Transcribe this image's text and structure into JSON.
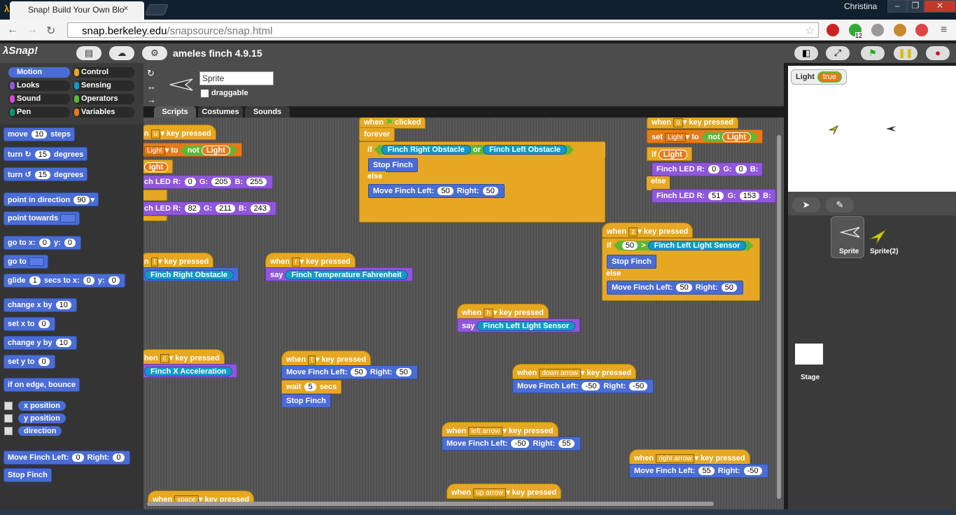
{
  "browser": {
    "tab_title": "Snap! Build Your Own Blo",
    "user": "Christina",
    "url_domain": "snap.berkeley.edu",
    "url_path": "/snapsource/snap.html",
    "ext_badge": "12"
  },
  "snap": {
    "logo": "λSnap!",
    "project_title": "ameles finch 4.9.15"
  },
  "categories": [
    {
      "label": "Motion",
      "color": "#4a6cd4"
    },
    {
      "label": "Control",
      "color": "#e6a822"
    },
    {
      "label": "Looks",
      "color": "#8f57d9"
    },
    {
      "label": "Sensing",
      "color": "#0d9ac9"
    },
    {
      "label": "Sound",
      "color": "#cf4ad9"
    },
    {
      "label": "Operators",
      "color": "#5fb733"
    },
    {
      "label": "Pen",
      "color": "#009870"
    },
    {
      "label": "Variables",
      "color": "#e67a1a"
    }
  ],
  "palette": {
    "move": [
      "move",
      "10",
      "steps"
    ],
    "turn_cw": [
      "turn",
      "15",
      "degrees"
    ],
    "turn_ccw": [
      "turn",
      "15",
      "degrees"
    ],
    "point_dir": [
      "point in direction",
      "90"
    ],
    "point_towards": "point towards",
    "goto_xy": [
      "go to x:",
      "0",
      "y:",
      "0"
    ],
    "goto": "go to",
    "glide": [
      "glide",
      "1",
      "secs to x:",
      "0",
      "y:",
      "0"
    ],
    "change_x": [
      "change x by",
      "10"
    ],
    "set_x": [
      "set x to",
      "0"
    ],
    "change_y": [
      "change y by",
      "10"
    ],
    "set_y": [
      "set y to",
      "0"
    ],
    "bounce": "if on edge, bounce",
    "x_pos": "x position",
    "y_pos": "y position",
    "dir": "direction",
    "move_finch": [
      "Move Finch Left:",
      "0",
      "Right:",
      "0"
    ],
    "stop_finch": "Stop Finch"
  },
  "sprite": {
    "name": "Sprite",
    "draggable": "draggable"
  },
  "tabs": [
    "Scripts",
    "Costumes",
    "Sounds"
  ],
  "scripts": {
    "s1": {
      "hat": [
        "n",
        "u",
        "key pressed"
      ],
      "set": [
        "Light",
        "to",
        "not",
        "Light"
      ],
      "if": "ight",
      "led1": [
        "ch LED R:",
        "0",
        "G:",
        "205",
        "B:",
        "255"
      ],
      "led2": [
        "ch LED R:",
        "82",
        "G:",
        "211",
        "B:",
        "243"
      ]
    },
    "s2": {
      "hat": [
        "when",
        "clicked"
      ],
      "forever": "forever",
      "if": "if",
      "r1": "Finch Right Obstacle",
      "or": "or",
      "r2": "Finch Left Obstacle",
      "stop": "Stop Finch",
      "else": "else",
      "move": [
        "Move Finch Left:",
        "50",
        "Right:",
        "50"
      ]
    },
    "s3": {
      "hat": [
        "when",
        "o",
        "key pressed"
      ],
      "set": [
        "set",
        "Light",
        "to",
        "not",
        "Light"
      ],
      "if": "if",
      "light": "Light",
      "led1": [
        "Finch LED R:",
        "0",
        "G:",
        "0",
        "B:"
      ],
      "else": "else",
      "led2": [
        "Finch LED R:",
        "51",
        "G:",
        "153",
        "B:"
      ]
    },
    "s4": {
      "hat": [
        "n",
        "l",
        "key pressed"
      ],
      "rep": "Finch Right Obstacle"
    },
    "s5": {
      "hat": [
        "when",
        "r",
        "key pressed"
      ],
      "say": "say",
      "rep": "Finch Temperature Fahrenheit"
    },
    "s6": {
      "hat": [
        "when",
        "z",
        "key pressed"
      ],
      "if": "if",
      "val": "50",
      "gt": ">",
      "sensor": "Finch Left Light Sensor",
      "stop": "Stop Finch",
      "else": "else",
      "move": [
        "Move Finch Left:",
        "50",
        "Right:",
        "50"
      ]
    },
    "s7": {
      "hat": [
        "when",
        "h",
        "key pressed"
      ],
      "say": "say",
      "rep": "Finch Left Light Sensor"
    },
    "s8": {
      "hat": [
        "hen",
        "c",
        "key pressed"
      ],
      "rep": "Finch X Acceleration"
    },
    "s9": {
      "hat": [
        "when",
        "t",
        "key pressed"
      ],
      "move": [
        "Move Finch Left:",
        "50",
        "Right:",
        "50"
      ],
      "wait": [
        "wait",
        "5",
        "secs"
      ],
      "stop": "Stop Finch"
    },
    "s10": {
      "hat": [
        "when",
        "down arrow",
        "key pressed"
      ],
      "move": [
        "Move Finch Left:",
        "-50",
        "Right:",
        "-50"
      ]
    },
    "s11": {
      "hat": [
        "when",
        "left arrow",
        "key pressed"
      ],
      "move": [
        "Move Finch Left:",
        "-50",
        "Right:",
        "55"
      ]
    },
    "s12": {
      "hat": [
        "when",
        "right arrow",
        "key pressed"
      ],
      "move": [
        "Move Finch Left:",
        "55",
        "Right:",
        "-50"
      ]
    },
    "s13": {
      "hat": [
        "when",
        "space",
        "key pressed"
      ]
    },
    "s14": {
      "hat": [
        "when",
        "up arrow",
        "key pressed"
      ]
    }
  },
  "stage": {
    "watcher_label": "Light",
    "watcher_value": "true"
  },
  "corral": {
    "sprite1": "Sprite",
    "sprite2": "Sprite(2)",
    "stage": "Stage"
  }
}
